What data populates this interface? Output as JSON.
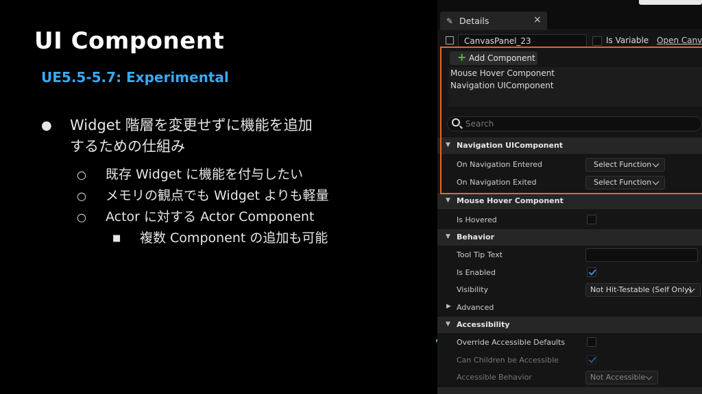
{
  "slide": {
    "title": "UI Component",
    "subtitle": "UE5.5-5.7: Experimental",
    "bullet_main_line1": "Widget 階層を変更せずに機能を追加",
    "bullet_main_line2": "するための仕組み",
    "sub_bullets": [
      "既存 Widget に機能を付与したい",
      "メモリの観点でも Widget よりも軽量",
      "Actor に対する Actor Component"
    ],
    "sub_sub_bullet": "複数 Component の追加も可能",
    "bullet_glyph": "●",
    "sub_bullet_glyph": "○",
    "sub_sub_bullet_glyph": "■"
  },
  "details": {
    "tab_label": "Details",
    "tab_close": "×",
    "widget_name": "CanvasPanel_23",
    "is_variable_label": "Is Variable",
    "open_canvas_label": "Open Canvas",
    "add_component_label": "Add Component",
    "components": [
      "Mouse Hover Component",
      "Navigation UIComponent"
    ],
    "search_placeholder": "Search",
    "sections": {
      "navigation": {
        "title": "Navigation UIComponent",
        "rows": [
          {
            "label": "On Navigation Entered",
            "value": "Select Function"
          },
          {
            "label": "On Navigation Exited",
            "value": "Select Function"
          }
        ]
      },
      "mouse_hover": {
        "title": "Mouse Hover Component",
        "rows": [
          {
            "label": "Is Hovered",
            "checked": false
          }
        ]
      },
      "behavior": {
        "title": "Behavior",
        "tooltip_label": "Tool Tip Text",
        "is_enabled_label": "Is Enabled",
        "visibility_label": "Visibility",
        "visibility_value": "Not Hit-Testable (Self Only)"
      },
      "advanced": {
        "title": "Advanced"
      },
      "accessibility": {
        "title": "Accessibility",
        "override_label": "Override Accessible Defaults",
        "children_label": "Can Children be Accessible",
        "behavior_label": "Accessible Behavior",
        "behavior_value": "Not Accessible"
      }
    }
  },
  "colors": {
    "subtitle_blue": "#3ba9f0",
    "highlight_orange": "#e8662c",
    "checkbox_blue": "#3f8fe0",
    "add_plus_green": "#4fbf3a"
  }
}
